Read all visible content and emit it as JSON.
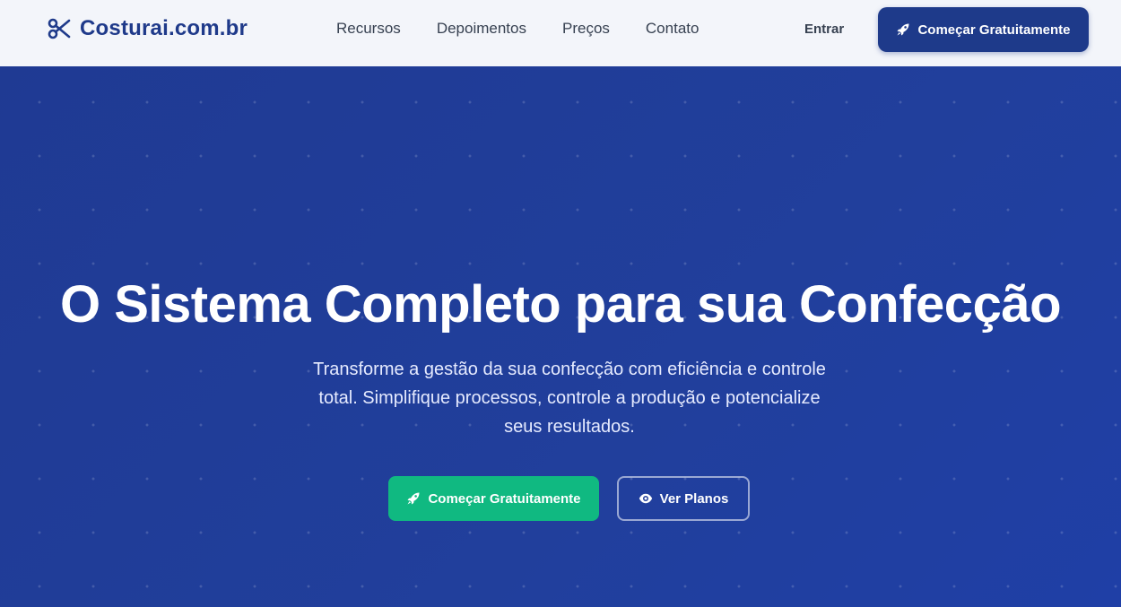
{
  "brand": {
    "name": "Costurai.com.br",
    "icon": "scissors-icon",
    "color": "#1f3a8a"
  },
  "nav": {
    "links": [
      "Recursos",
      "Depoimentos",
      "Preços",
      "Contato"
    ],
    "login": "Entrar",
    "cta": {
      "label": "Começar Gratuitamente",
      "icon": "rocket-icon"
    }
  },
  "hero": {
    "title": "O Sistema Completo para sua Confecção",
    "subtitle": "Transforme a gestão da sua confecção com eficiência e controle total. Simplifique processos, controle a produção e potencialize seus resultados.",
    "primary_cta": {
      "label": "Começar Gratuitamente",
      "icon": "rocket-icon"
    },
    "secondary_cta": {
      "label": "Ver Planos",
      "icon": "eye-icon"
    }
  },
  "colors": {
    "nav_bg": "#f3f5fa",
    "hero_bg": "#1f3a99",
    "primary_dark": "#1e3a8a",
    "accent_green": "#10b981"
  }
}
